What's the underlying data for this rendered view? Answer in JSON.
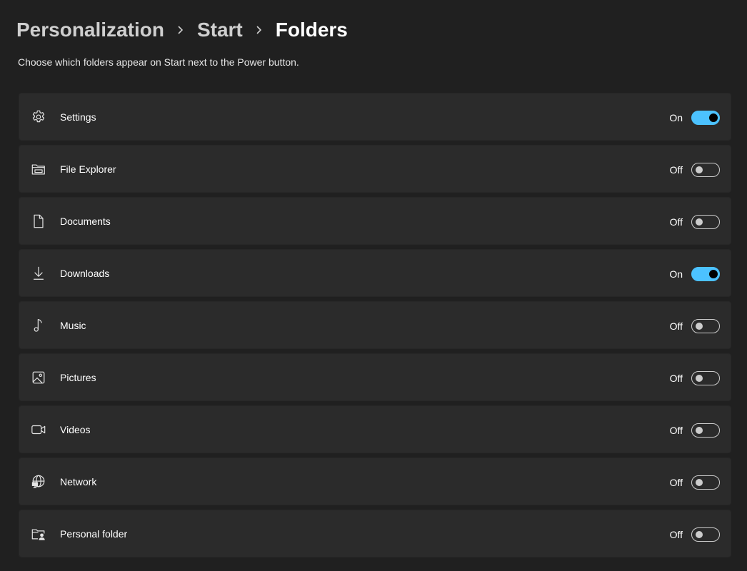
{
  "breadcrumb": {
    "items": [
      "Personalization",
      "Start"
    ],
    "current": "Folders"
  },
  "description": "Choose which folders appear on Start next to the Power button.",
  "colors": {
    "accent": "#4cc2ff",
    "background": "#202020",
    "card": "#2b2b2b"
  },
  "folders": [
    {
      "label": "Settings",
      "icon": "gear-icon",
      "state": "On",
      "on": true
    },
    {
      "label": "File Explorer",
      "icon": "folder-icon",
      "state": "Off",
      "on": false
    },
    {
      "label": "Documents",
      "icon": "document-icon",
      "state": "Off",
      "on": false
    },
    {
      "label": "Downloads",
      "icon": "download-icon",
      "state": "On",
      "on": true
    },
    {
      "label": "Music",
      "icon": "music-note-icon",
      "state": "Off",
      "on": false
    },
    {
      "label": "Pictures",
      "icon": "picture-icon",
      "state": "Off",
      "on": false
    },
    {
      "label": "Videos",
      "icon": "video-camera-icon",
      "state": "Off",
      "on": false
    },
    {
      "label": "Network",
      "icon": "network-globe-icon",
      "state": "Off",
      "on": false
    },
    {
      "label": "Personal folder",
      "icon": "personal-folder-icon",
      "state": "Off",
      "on": false
    }
  ]
}
